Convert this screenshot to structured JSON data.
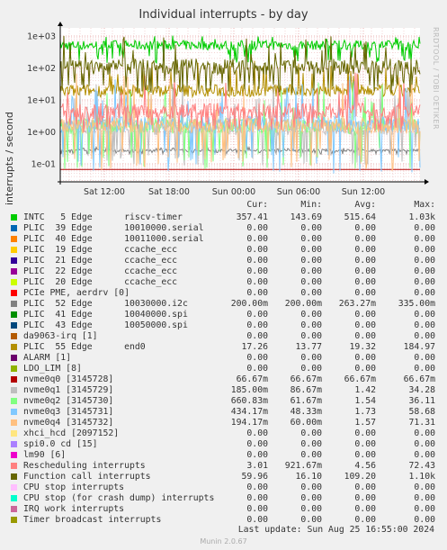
{
  "title": "Individual interrupts - by day",
  "watermark": "RRDTOOL / TOBI OETIKER",
  "footer": "Munin 2.0.67",
  "last_update": "Last update: Sun Aug 25 16:55:00 2024",
  "legend_headers": {
    "cur": "Cur:",
    "min": "Min:",
    "avg": "Avg:",
    "max": "Max:"
  },
  "chart_data": {
    "type": "line",
    "title": "Individual interrupts - by day",
    "ylabel": "interrupts / second",
    "y_scale": "log",
    "ylim": [
      0.05,
      2000
    ],
    "y_ticks": [
      "1e+03",
      "1e+02",
      "1e+01",
      "1e+00",
      "1e-01"
    ],
    "x_ticks": [
      "Sat 12:00",
      "Sat 18:00",
      "Sun 00:00",
      "Sun 06:00",
      "Sun 12:00"
    ],
    "grid": true,
    "series": [
      {
        "name": "INTC   5 Edge      riscv-timer",
        "color": "#00cc00",
        "cur": "357.41",
        "min": "143.69",
        "avg": "515.64",
        "max": "1.03k"
      },
      {
        "name": "PLIC  39 Edge      10010000.serial",
        "color": "#0066b3",
        "cur": "0.00",
        "min": "0.00",
        "avg": "0.00",
        "max": "0.00"
      },
      {
        "name": "PLIC  40 Edge      10011000.serial",
        "color": "#ff8000",
        "cur": "0.00",
        "min": "0.00",
        "avg": "0.00",
        "max": "0.00"
      },
      {
        "name": "PLIC  19 Edge      ccache_ecc",
        "color": "#ffcc00",
        "cur": "0.00",
        "min": "0.00",
        "avg": "0.00",
        "max": "0.00"
      },
      {
        "name": "PLIC  21 Edge      ccache_ecc",
        "color": "#330099",
        "cur": "0.00",
        "min": "0.00",
        "avg": "0.00",
        "max": "0.00"
      },
      {
        "name": "PLIC  22 Edge      ccache_ecc",
        "color": "#990099",
        "cur": "0.00",
        "min": "0.00",
        "avg": "0.00",
        "max": "0.00"
      },
      {
        "name": "PLIC  20 Edge      ccache_ecc",
        "color": "#ccff00",
        "cur": "0.00",
        "min": "0.00",
        "avg": "0.00",
        "max": "0.00"
      },
      {
        "name": "PCIe PME, aerdrv [0]",
        "color": "#ff0000",
        "cur": "0.00",
        "min": "0.00",
        "avg": "0.00",
        "max": "0.00"
      },
      {
        "name": "PLIC  52 Edge      10030000.i2c",
        "color": "#808080",
        "cur": "200.00m",
        "min": "200.00m",
        "avg": "263.27m",
        "max": "335.00m"
      },
      {
        "name": "PLIC  41 Edge      10040000.spi",
        "color": "#008f00",
        "cur": "0.00",
        "min": "0.00",
        "avg": "0.00",
        "max": "0.00"
      },
      {
        "name": "PLIC  43 Edge      10050000.spi",
        "color": "#00487d",
        "cur": "0.00",
        "min": "0.00",
        "avg": "0.00",
        "max": "0.00"
      },
      {
        "name": "da9063-irq [1]",
        "color": "#b35a00",
        "cur": "0.00",
        "min": "0.00",
        "avg": "0.00",
        "max": "0.00"
      },
      {
        "name": "PLIC  55 Edge      end0",
        "color": "#b38f00",
        "cur": "17.26",
        "min": "13.77",
        "avg": "19.32",
        "max": "184.97"
      },
      {
        "name": "ALARM [1]",
        "color": "#6b006b",
        "cur": "0.00",
        "min": "0.00",
        "avg": "0.00",
        "max": "0.00"
      },
      {
        "name": "LDO_LIM [8]",
        "color": "#8fb300",
        "cur": "0.00",
        "min": "0.00",
        "avg": "0.00",
        "max": "0.00"
      },
      {
        "name": "nvme0q0 [3145728]",
        "color": "#b30000",
        "cur": "66.67m",
        "min": "66.67m",
        "avg": "66.67m",
        "max": "66.67m"
      },
      {
        "name": "nvme0q1 [3145729]",
        "color": "#bebebe",
        "cur": "185.00m",
        "min": "86.67m",
        "avg": "1.42",
        "max": "34.28"
      },
      {
        "name": "nvme0q2 [3145730]",
        "color": "#80ff80",
        "cur": "660.83m",
        "min": "61.67m",
        "avg": "1.54",
        "max": "36.11"
      },
      {
        "name": "nvme0q3 [3145731]",
        "color": "#80c9ff",
        "cur": "434.17m",
        "min": "48.33m",
        "avg": "1.73",
        "max": "58.68"
      },
      {
        "name": "nvme0q4 [3145732]",
        "color": "#ffc080",
        "cur": "194.17m",
        "min": "60.00m",
        "avg": "1.57",
        "max": "71.31"
      },
      {
        "name": "xhci_hcd [2097152]",
        "color": "#ffe680",
        "cur": "0.00",
        "min": "0.00",
        "avg": "0.00",
        "max": "0.00"
      },
      {
        "name": "spi0.0 cd [15]",
        "color": "#aa80ff",
        "cur": "0.00",
        "min": "0.00",
        "avg": "0.00",
        "max": "0.00"
      },
      {
        "name": "lm90 [6]",
        "color": "#ee00cc",
        "cur": "0.00",
        "min": "0.00",
        "avg": "0.00",
        "max": "0.00"
      },
      {
        "name": "Rescheduling interrupts",
        "color": "#ff8080",
        "cur": "3.01",
        "min": "921.67m",
        "avg": "4.56",
        "max": "72.43"
      },
      {
        "name": "Function call interrupts",
        "color": "#666600",
        "cur": "59.96",
        "min": "16.10",
        "avg": "109.20",
        "max": "1.10k"
      },
      {
        "name": "CPU stop interrupts",
        "color": "#ffbfff",
        "cur": "0.00",
        "min": "0.00",
        "avg": "0.00",
        "max": "0.00"
      },
      {
        "name": "CPU stop (for crash dump) interrupts",
        "color": "#00ffcc",
        "cur": "0.00",
        "min": "0.00",
        "avg": "0.00",
        "max": "0.00"
      },
      {
        "name": "IRQ work interrupts",
        "color": "#cc6699",
        "cur": "0.00",
        "min": "0.00",
        "avg": "0.00",
        "max": "0.00"
      },
      {
        "name": "Timer broadcast interrupts",
        "color": "#999900",
        "cur": "0.00",
        "min": "0.00",
        "avg": "0.00",
        "max": "0.00"
      }
    ]
  }
}
